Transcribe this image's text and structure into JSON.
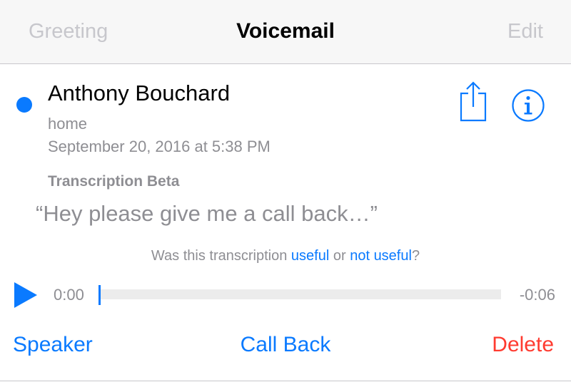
{
  "navbar": {
    "left_label": "Greeting",
    "title": "Voicemail",
    "right_label": "Edit"
  },
  "voicemail": {
    "caller_name": "Anthony Bouchard",
    "number_label": "home",
    "date": "September 20, 2016 at 5:38 PM",
    "unread": true
  },
  "transcription": {
    "title": "Transcription Beta",
    "text": "“Hey please give me a call back…”"
  },
  "feedback": {
    "prefix": "Was this transcription ",
    "useful_link": "useful",
    "middle": " or ",
    "not_useful_link": "not useful",
    "suffix": "?"
  },
  "player": {
    "elapsed": "0:00",
    "remaining": "-0:06",
    "progress": 0.0
  },
  "actions": {
    "speaker": "Speaker",
    "call_back": "Call Back",
    "delete": "Delete"
  },
  "icons": {
    "share": "share-icon",
    "info": "info-icon",
    "play": "play-icon"
  },
  "colors": {
    "accent": "#0a7aff",
    "destructive": "#ff3b30",
    "secondary_text": "#8e8e93",
    "disabled_text": "#c7c7cc"
  }
}
